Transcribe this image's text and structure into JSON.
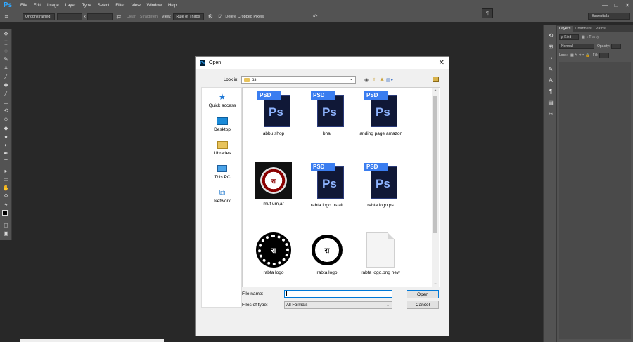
{
  "app": {
    "logo": "Ps"
  },
  "menu": [
    "File",
    "Edit",
    "Image",
    "Layer",
    "Type",
    "Select",
    "Filter",
    "View",
    "Window",
    "Help"
  ],
  "window_controls": [
    "—",
    "□",
    "✕"
  ],
  "options_bar": {
    "ratio": "Unconstrained",
    "x_sep": "x",
    "clear": "Clear",
    "straighten": "Straighten",
    "view_label": "View:",
    "view_value": "Rule of Thirds",
    "delete_cropped": "Delete Cropped Pixels",
    "workspace": "Essentials"
  },
  "layers_panel": {
    "tabs": [
      "Layers",
      "Channels",
      "Paths"
    ],
    "kind": "ρ Kind",
    "blend": "Normal",
    "opacity_label": "Opacity:",
    "lock_label": "Lock:",
    "fill_label": "Fill:"
  },
  "dialog": {
    "title": "Open",
    "icon": "Ps",
    "look_in_label": "Look in:",
    "look_in_value": "ps",
    "places": [
      {
        "label": "Quick access",
        "icon": "star-icon"
      },
      {
        "label": "Desktop",
        "icon": "desktop-icon"
      },
      {
        "label": "Libraries",
        "icon": "libraries-icon"
      },
      {
        "label": "This PC",
        "icon": "computer-icon"
      },
      {
        "label": "Network",
        "icon": "network-icon"
      }
    ],
    "files": [
      {
        "name": "abbu shop",
        "type": "psd"
      },
      {
        "name": "bhai",
        "type": "psd"
      },
      {
        "name": "landing page amazon",
        "type": "psd"
      },
      {
        "name": "muf um,ar",
        "type": "image-red"
      },
      {
        "name": "rabta logo ps alt",
        "type": "psd"
      },
      {
        "name": "rabta logo ps",
        "type": "psd"
      },
      {
        "name": "rabta logo",
        "type": "image-gear"
      },
      {
        "name": "rabta logo",
        "type": "image-ring"
      },
      {
        "name": "rabta logo.png new",
        "type": "blank"
      }
    ],
    "psd_badge": "PSD",
    "ps_text": "Ps",
    "file_name_label": "File name:",
    "file_name_value": "",
    "files_of_type_label": "Files of type:",
    "files_of_type_value": "All Formats",
    "open_button": "Open",
    "cancel_button": "Cancel"
  }
}
